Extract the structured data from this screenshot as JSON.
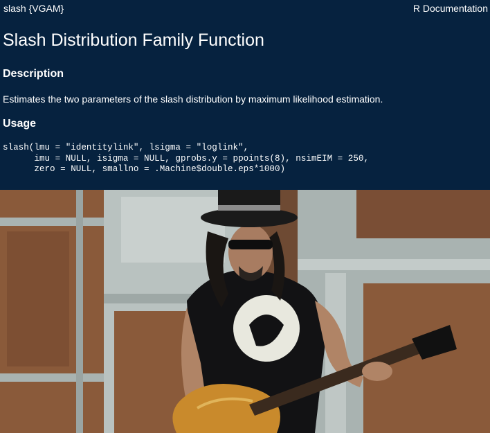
{
  "header": {
    "package_label": "slash {VGAM}",
    "doc_label": "R Documentation"
  },
  "title": "Slash Distribution Family Function",
  "description": {
    "heading": "Description",
    "text": "Estimates the two parameters of the slash distribution by maximum likelihood estimation."
  },
  "usage": {
    "heading": "Usage",
    "line1": "slash(lmu = \"identitylink\", lsigma = \"loglink\",",
    "line2": "      imu = NULL, isigma = NULL, gprobs.y = ppoints(8), nsimEIM = 250,",
    "line3": "      zero = NULL, smallno = .Machine$double.eps*1000)"
  },
  "photo": {
    "subject": "guitarist-with-top-hat-photo",
    "colors": {
      "wall_wood": "#8a5a3a",
      "panel_grey": "#b9c2c0",
      "shirt": "#121214",
      "guitar_top": "#c98a2c",
      "hat": "#1a1a1a"
    }
  }
}
